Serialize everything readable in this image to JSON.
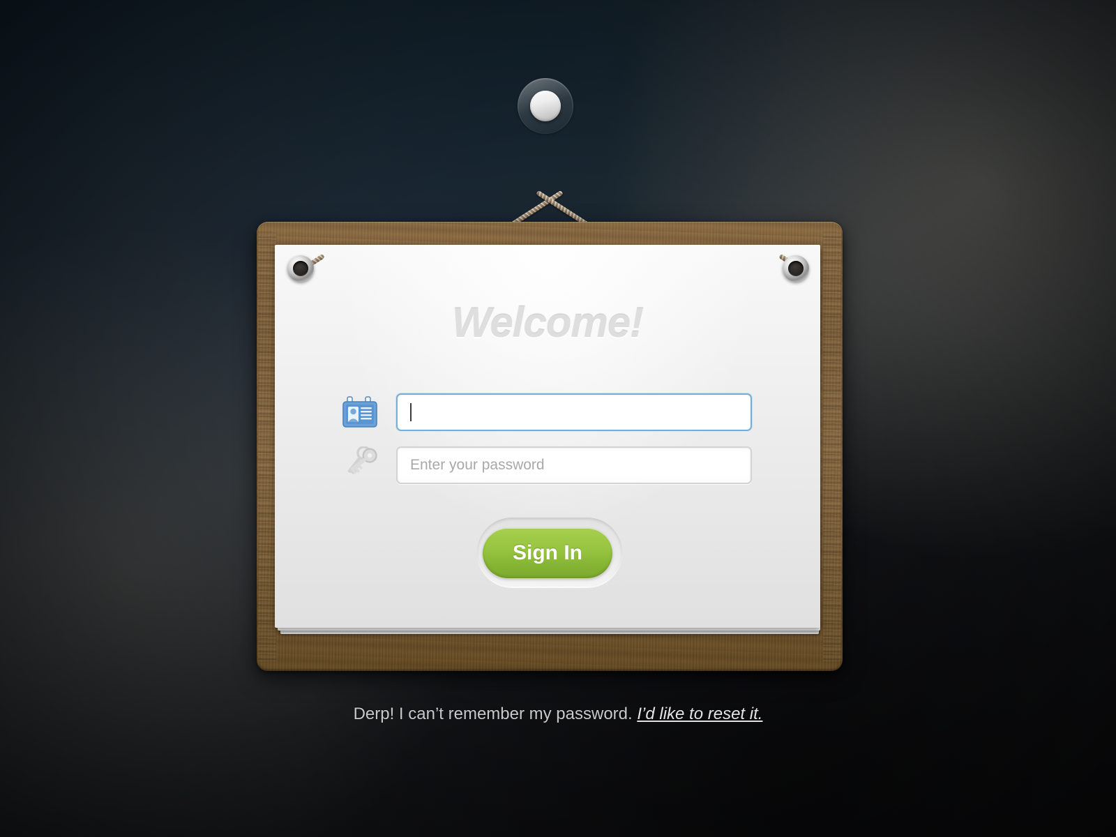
{
  "title": "Welcome!",
  "form": {
    "username": {
      "icon": "id-badge-icon",
      "value": "",
      "placeholder": ""
    },
    "password": {
      "icon": "keys-icon",
      "value": "",
      "placeholder": "Enter your password"
    },
    "submit_label": "Sign In"
  },
  "footer": {
    "message": "Derp! I can’t remember my password.",
    "link_label": "I’d like to reset it."
  },
  "colors": {
    "accent_green": "#97c440",
    "focus_blue": "#74b0d4",
    "wood_brown": "#8b6b41",
    "paper_white": "#f3f3f3",
    "background_dark": "#1d2730",
    "badge_blue": "#5b95d1",
    "key_gray": "#c6c6c6"
  }
}
